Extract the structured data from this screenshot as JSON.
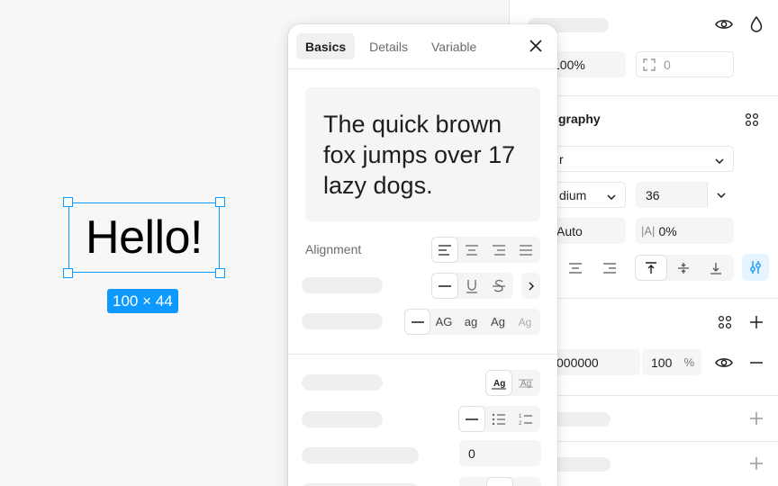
{
  "canvas": {
    "text": "Hello!",
    "size_label": "100 × 44"
  },
  "panel": {
    "opacity": "100%",
    "corner": "0",
    "section_title": "graphy",
    "font_family": "r",
    "font_weight": "dium",
    "font_size": "36",
    "line_height": "Auto",
    "letter_spacing_prefix": "|A|",
    "letter_spacing": "0%",
    "fill_hex": "000000",
    "fill_opacity": "100",
    "fill_opacity_unit": "%"
  },
  "popover": {
    "tabs": [
      {
        "label": "Basics"
      },
      {
        "label": "Details"
      },
      {
        "label": "Variable"
      }
    ],
    "preview_text": "The quick brown fox jumps over 17 lazy dogs.",
    "alignment_label": "Alignment",
    "case_options": [
      "AG",
      "ag",
      "Ag",
      "Ag"
    ],
    "paragraph_spacing": "0"
  },
  "colors": {
    "accent": "#0d99ff",
    "panel_bg": "#ffffff",
    "canvas_bg": "#f7f7f7"
  }
}
